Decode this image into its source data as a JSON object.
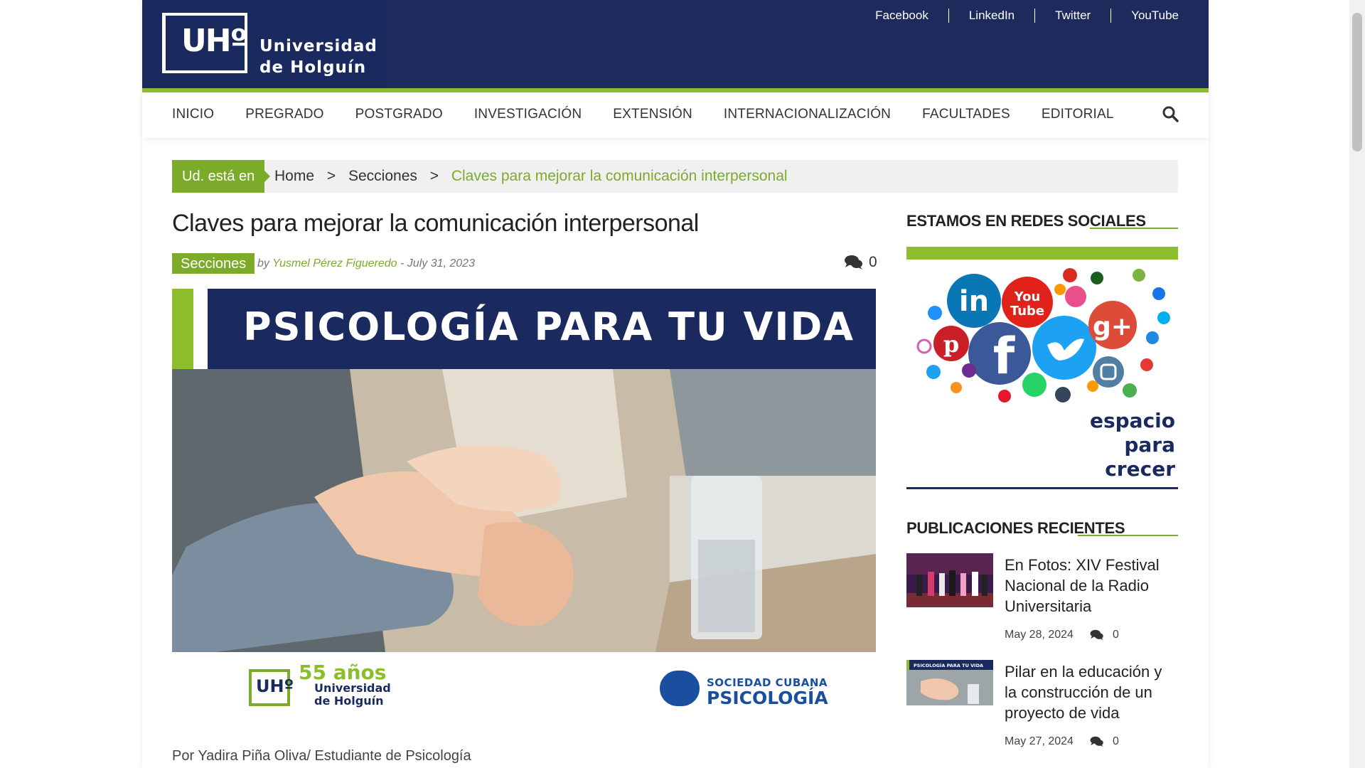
{
  "brand": {
    "mark": "UHº",
    "line1": "Universidad",
    "line2": "de Holguín"
  },
  "social_top": [
    "Facebook",
    "LinkedIn",
    "Twitter",
    "YouTube"
  ],
  "nav": [
    "INICIO",
    "PREGRADO",
    "POSTGRADO",
    "INVESTIGACIÓN",
    "EXTENSIÓN",
    "INTERNACIONALIZACIÓN",
    "FACULTADES",
    "EDITORIAL"
  ],
  "breadcrumb": {
    "tag": "Ud. está en",
    "items": [
      "Home",
      "Secciones"
    ],
    "separator": ">",
    "current": "Claves para mejorar la comunicación interpersonal"
  },
  "article": {
    "title": "Claves para mejorar la comunicación interpersonal",
    "category": "Secciones",
    "by": "by",
    "author": "Yusmel Pérez Figueredo",
    "date": "- July 31, 2023",
    "comments": "0",
    "hero_banner": "PSICOLOGÍA PARA TU VIDA",
    "hero_logo_55": "55 años",
    "hero_logo_name1": "Universidad",
    "hero_logo_name2": "de Holguín",
    "hero_logo_mark": "UHº",
    "hero_scp1": "SOCIEDAD CUBANA",
    "hero_scp2": "PSICOLOGÍA",
    "byline": "Por Yadira Piña Oliva/ Estudiante de Psicología"
  },
  "sidebar": {
    "social_heading": "ESTAMOS EN REDES SOCIALES",
    "social_caption": [
      "espacio",
      "para",
      "crecer"
    ],
    "recent_heading": "PUBLICACIONES RECIENTES",
    "posts": [
      {
        "title": "En Fotos: XIV Festival Nacional de la Radio Universitaria",
        "date": "May 28, 2024",
        "comments": "0",
        "thumb_label": ""
      },
      {
        "title": "Pilar en la educación y la construcción de un proyecto de vida",
        "date": "May 27, 2024",
        "comments": "0",
        "thumb_label": "PSICOLOGÍA PARA TU VIDA"
      }
    ]
  },
  "colors": {
    "navy": "#1c2b5c",
    "green": "#7cab2a",
    "light_green": "#8cbd2c"
  }
}
